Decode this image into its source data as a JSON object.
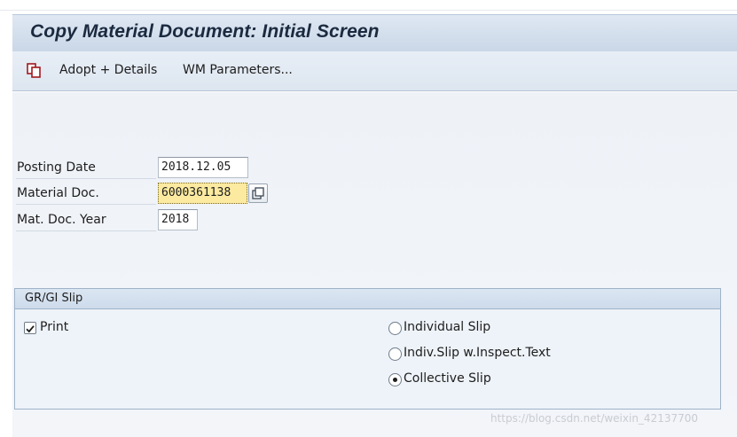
{
  "title": "Copy Material Document: Initial Screen",
  "toolbar": {
    "copy_icon": "copy-documents-icon",
    "adopt_details": "Adopt + Details",
    "wm_parameters": "WM Parameters..."
  },
  "fields": {
    "posting_date": {
      "label": "Posting Date",
      "value": "2018.12.05"
    },
    "material_doc": {
      "label": "Material Doc.",
      "value": "6000361138",
      "value_help_icon": "value-help-icon"
    },
    "mat_doc_year": {
      "label": "Mat. Doc. Year",
      "value": "2018"
    }
  },
  "slip_group": {
    "title": "GR/GI Slip",
    "print": {
      "label": "Print",
      "checked": true
    },
    "options": [
      {
        "label": "Individual Slip",
        "selected": false
      },
      {
        "label": "Indiv.Slip w.Inspect.Text",
        "selected": false
      },
      {
        "label": "Collective Slip",
        "selected": true
      }
    ]
  },
  "watermark": "https://blog.csdn.net/weixin_42137700",
  "colors": {
    "title_bar": "#cad7e7",
    "toolbar": "#dde6f0",
    "content_bg": "#eef2f7",
    "focused_field": "#fbeaa0",
    "title_text": "#1b2a3f"
  }
}
